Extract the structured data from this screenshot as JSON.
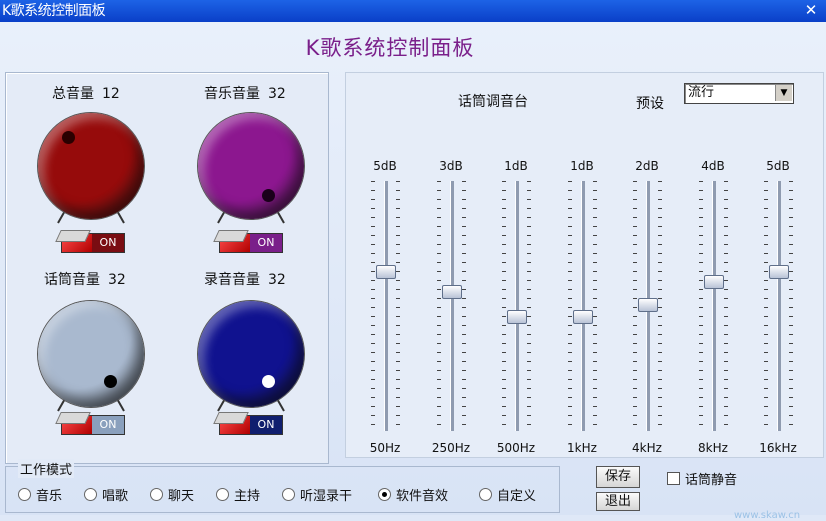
{
  "window": {
    "title": "K歌系统控制面板",
    "close_glyph": "✕"
  },
  "app_title": "K歌系统控制面板",
  "channels": [
    {
      "label": "总音量",
      "value": "12",
      "color": "#960b0b",
      "dot_color": "#2a0000",
      "switch": "ON",
      "switch_color": "#7a0d12"
    },
    {
      "label": "音乐音量",
      "value": "32",
      "color": "#8c178f",
      "dot_color": "#1a001a",
      "switch": "ON",
      "switch_color": "#7a1f8a"
    },
    {
      "label": "话筒音量",
      "value": "32",
      "color": "#a9b9cf",
      "dot_color": "#000000",
      "switch": "ON",
      "switch_color": "#8aa0bd"
    },
    {
      "label": "录音音量",
      "value": "32",
      "color": "#10128f",
      "dot_color": "#ffffff",
      "switch": "ON",
      "switch_color": "#0f1e6e"
    }
  ],
  "equalizer": {
    "title": "话筒调音台",
    "preset_label": "预设",
    "preset_value": "流行",
    "bands": [
      {
        "db": "5dB",
        "freq": "50Hz",
        "level": 0.64
      },
      {
        "db": "3dB",
        "freq": "250Hz",
        "level": 0.56
      },
      {
        "db": "1dB",
        "freq": "500Hz",
        "level": 0.46
      },
      {
        "db": "1dB",
        "freq": "1kHz",
        "level": 0.46
      },
      {
        "db": "2dB",
        "freq": "4kHz",
        "level": 0.51
      },
      {
        "db": "4dB",
        "freq": "8kHz",
        "level": 0.6
      },
      {
        "db": "5dB",
        "freq": "16kHz",
        "level": 0.64
      }
    ]
  },
  "work_mode": {
    "legend": "工作模式",
    "options": [
      "音乐",
      "唱歌",
      "聊天",
      "主持",
      "听湿录干",
      "软件音效",
      "自定义"
    ],
    "selected": "软件音效"
  },
  "buttons": {
    "save": "保存",
    "secondary": "退出"
  },
  "checkbox": {
    "label": "话筒静音"
  },
  "watermark": "www.skaw.cn"
}
